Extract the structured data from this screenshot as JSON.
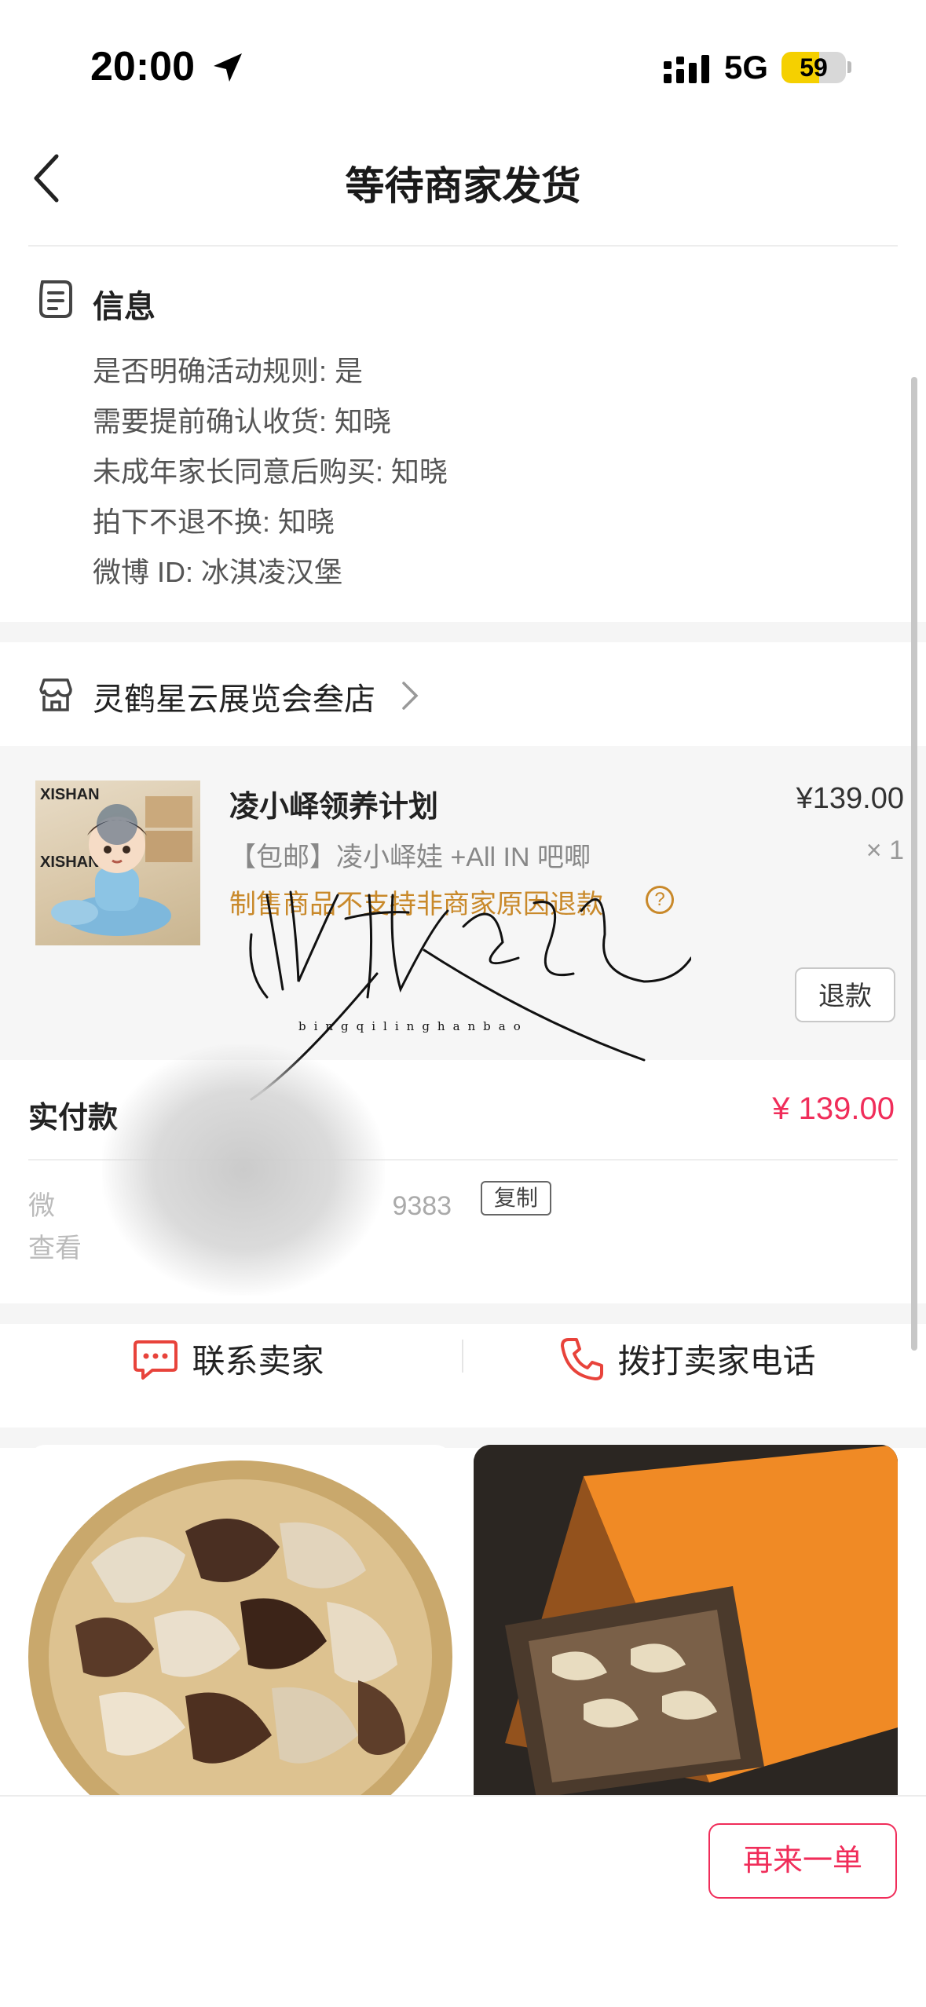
{
  "status_bar": {
    "time": "20:00",
    "network": "5G",
    "battery": "59",
    "battery_level_percent": 59
  },
  "nav": {
    "title": "等待商家发货"
  },
  "info": {
    "title": "信息",
    "lines": [
      "是否明确活动规则: 是",
      "需要提前确认收货: 知晓",
      "未成年家长同意后购买: 知晓",
      "拍下不退不换: 知晓",
      "微博 ID: 冰淇凌汉堡"
    ]
  },
  "store": {
    "name": "灵鹤星云展览会叁店"
  },
  "product": {
    "thumb_text": "XISHAN",
    "name": "凌小峄领养计划",
    "price": "¥139.00",
    "spec": "【包邮】凌小峄娃 +All IN 吧唧",
    "quantity": "× 1",
    "note": "制售商品不支持非商家原因退款",
    "refund_label": "退款"
  },
  "payment": {
    "paid_label": "实付款",
    "paid_value": "¥ 139.00",
    "order_prefix": "微",
    "order_suffix": "9383",
    "copy_label": "复制",
    "view_prefix": "查看"
  },
  "contact": {
    "contact_seller": "联系卖家",
    "call_seller": "拨打卖家电话"
  },
  "watermark": {
    "text": "bingqilinghanbao"
  },
  "bottom": {
    "reorder_label": "再来一单"
  },
  "colors": {
    "accent": "#f02d5a",
    "note": "#c9892a",
    "contact_icon": "#e8433b"
  }
}
